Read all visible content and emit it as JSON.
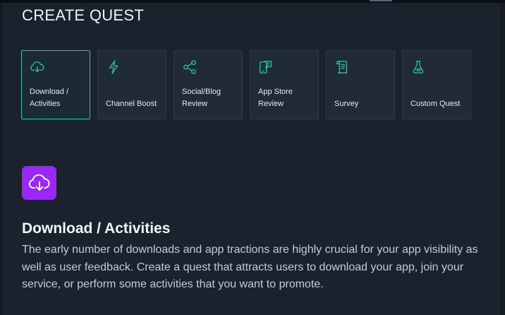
{
  "page": {
    "title": "CREATE QUEST"
  },
  "quest_types": [
    {
      "id": "download",
      "label": "Download / Activities",
      "icon": "cloud-download-icon",
      "selected": true
    },
    {
      "id": "channel",
      "label": "Channel Boost",
      "icon": "lightning-icon",
      "selected": false
    },
    {
      "id": "social",
      "label": "Social/Blog Review",
      "icon": "share-icon",
      "selected": false
    },
    {
      "id": "appstore",
      "label": "App Store Review",
      "icon": "app-review-icon",
      "selected": false
    },
    {
      "id": "survey",
      "label": "Survey",
      "icon": "scroll-icon",
      "selected": false
    },
    {
      "id": "custom",
      "label": "Custom Quest",
      "icon": "flask-icon",
      "selected": false
    }
  ],
  "detail": {
    "title": "Download / Activities",
    "description": "The early number of downloads and app tractions are highly crucial for your app visibility as well as user feedback. Create a quest that attracts users to download your app, join your service, or perform some activities that you want to promote.",
    "icon": "cloud-download-icon"
  },
  "colors": {
    "accent": "#25c6b4",
    "icon_tile": "#9b27f5",
    "background": "#1a232d"
  }
}
